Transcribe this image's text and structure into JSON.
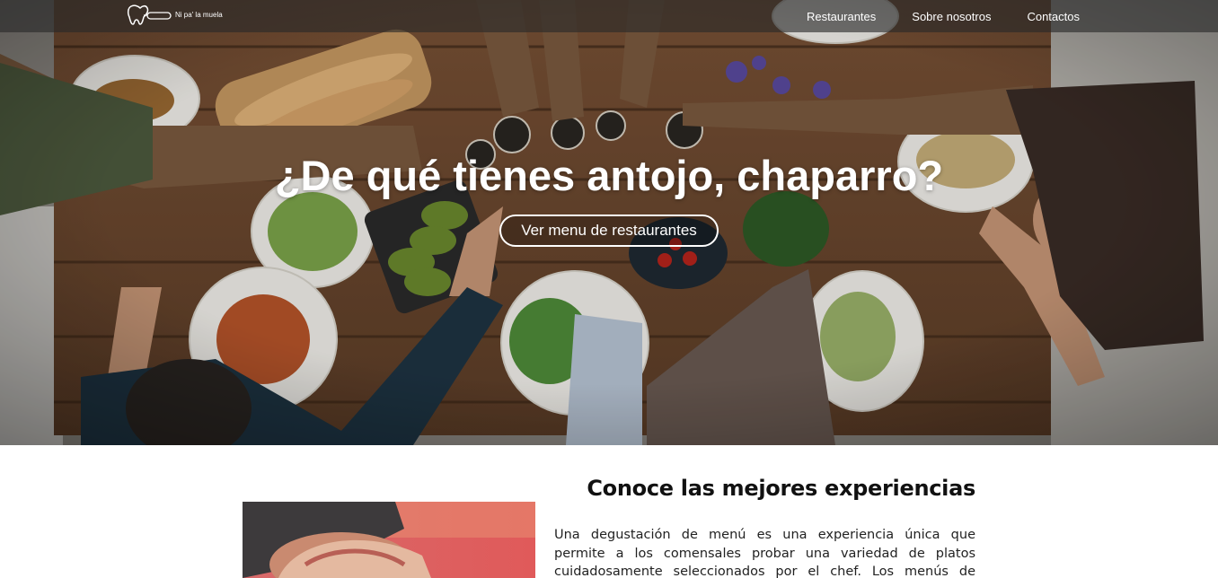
{
  "brand": {
    "name": "Ni pa' la muela"
  },
  "nav": {
    "items": [
      {
        "label": "Restaurantes"
      },
      {
        "label": "Sobre nosotros"
      },
      {
        "label": "Contactos"
      }
    ]
  },
  "hero": {
    "title": "¿De qué tienes antojo, chaparro?",
    "button_label": "Ver menu de restaurantes"
  },
  "experience": {
    "title": "Conoce las mejores experiencias",
    "paragraph": "Una degustación de menú es una experiencia única que permite a los comensales probar una variedad de platos cuidadosamente seleccionados por el chef. Los menús de degustación a menudo"
  },
  "colors": {
    "nav_bg": "#282828",
    "table_wood": "#6b4a33",
    "text_dark": "#111111",
    "white": "#ffffff"
  }
}
